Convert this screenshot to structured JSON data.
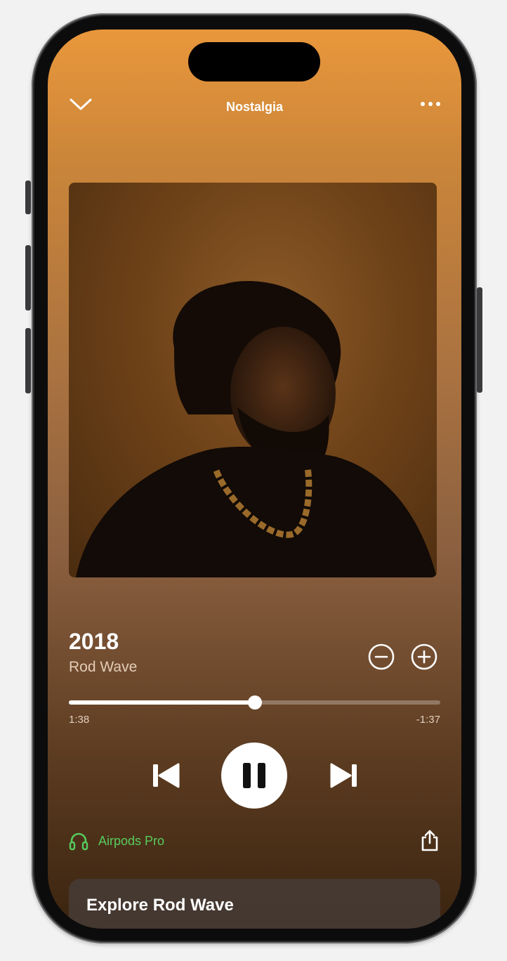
{
  "header": {
    "title": "Nostalgia",
    "collapse_icon": "chevron-down-icon",
    "more_icon": "ellipsis-icon"
  },
  "track": {
    "title": "2018",
    "artist": "Rod Wave",
    "elapsed": "1:38",
    "remaining": "-1:37",
    "progress": 0.5
  },
  "controls": {
    "previous_icon": "skip-back-icon",
    "pause_icon": "pause-icon",
    "next_icon": "skip-forward-icon",
    "remove_icon": "minus-circle-icon",
    "add_icon": "plus-circle-icon"
  },
  "output": {
    "device_label": "Airpods Pro",
    "device_icon": "headphones-icon",
    "accent": "#56cc5e"
  },
  "share_icon": "share-icon",
  "explore": {
    "title": "Explore Rod Wave"
  }
}
